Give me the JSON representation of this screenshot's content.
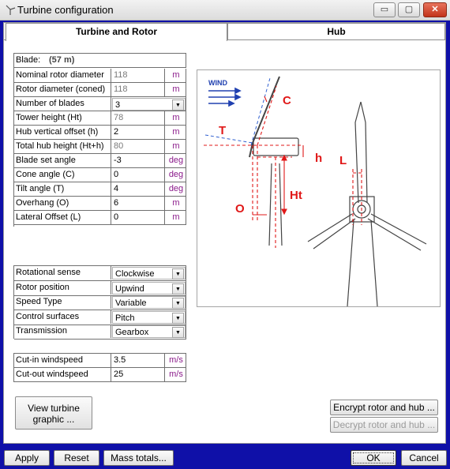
{
  "window": {
    "title": "Turbine configuration",
    "icon": "turbine-icon",
    "controls": {
      "minimize": "▭",
      "maximize": "▢",
      "close": "✕"
    }
  },
  "tabs": [
    {
      "label": "Turbine and Rotor",
      "active": true
    },
    {
      "label": "Hub",
      "active": false
    }
  ],
  "blade": {
    "label": "Blade:",
    "value": "(57 m)"
  },
  "params": [
    {
      "label": "Nominal rotor diameter",
      "value": "118",
      "unit": "m",
      "readonly": true
    },
    {
      "label": "Rotor diameter (coned)",
      "value": "118",
      "unit": "m",
      "readonly": true
    },
    {
      "label": "Number of blades",
      "value": "3",
      "unit": "",
      "combo": true
    },
    {
      "label": "Tower height (Ht)",
      "value": "78",
      "unit": "m",
      "readonly": true
    },
    {
      "label": "Hub vertical offset (h)",
      "value": "2",
      "unit": "m"
    },
    {
      "label": "Total hub height (Ht+h)",
      "value": "80",
      "unit": "m",
      "readonly": true
    },
    {
      "label": "Blade set angle",
      "value": "-3",
      "unit": "deg"
    },
    {
      "label": "Cone angle (C)",
      "value": "0",
      "unit": "deg"
    },
    {
      "label": "Tilt angle (T)",
      "value": "4",
      "unit": "deg"
    },
    {
      "label": "Overhang (O)",
      "value": "6",
      "unit": "m"
    },
    {
      "label": "Lateral Offset (L)",
      "value": "0",
      "unit": "m"
    }
  ],
  "options": [
    {
      "label": "Rotational sense",
      "value": "Clockwise"
    },
    {
      "label": "Rotor position",
      "value": "Upwind"
    },
    {
      "label": "Speed Type",
      "value": "Variable"
    },
    {
      "label": "Control surfaces",
      "value": "Pitch"
    },
    {
      "label": "Transmission",
      "value": "Gearbox"
    }
  ],
  "windspeeds": [
    {
      "label": "Cut-in windspeed",
      "value": "3.5",
      "unit": "m/s"
    },
    {
      "label": "Cut-out windspeed",
      "value": "25",
      "unit": "m/s"
    }
  ],
  "diagram": {
    "wind_label": "WIND",
    "labels": {
      "C": "C",
      "T": "T",
      "h": "h",
      "Ht": "Ht",
      "O": "O",
      "L": "L"
    },
    "colors": {
      "dimension": "#e01818",
      "dashed_blue": "#3060d0",
      "structure": "#444444"
    }
  },
  "buttons": {
    "view_graphic": "View turbine\ngraphic ...",
    "encrypt": "Encrypt rotor and hub ...",
    "decrypt": "Decrypt rotor and hub ...",
    "apply": "Apply",
    "reset": "Reset",
    "mass_totals": "Mass totals...",
    "ok": "OK",
    "cancel": "Cancel"
  }
}
